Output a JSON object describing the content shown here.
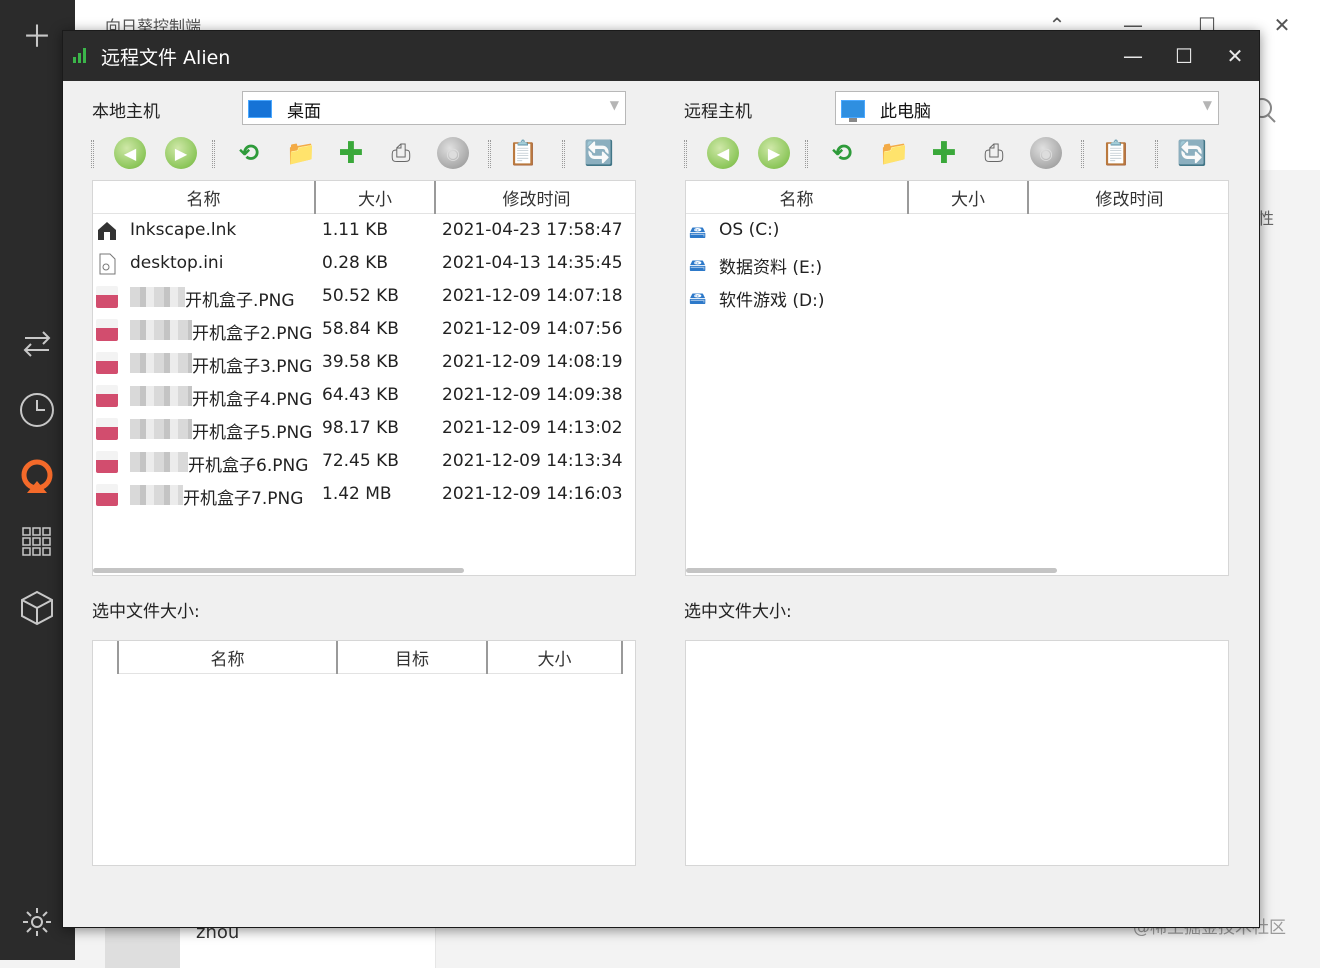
{
  "background_app": {
    "title": "向日葵控制端",
    "side_text": "性",
    "user": "zhou",
    "watermark": "@稀土掘金技术社区",
    "rail_icons": [
      "plus-icon",
      "transfer-icon",
      "clock-icon",
      "sunflower-logo-icon",
      "apps-icon",
      "cube-icon",
      "settings-icon"
    ],
    "window_controls": [
      "collapse-icon",
      "minimize-icon",
      "maximize-icon",
      "close-icon"
    ]
  },
  "dialog": {
    "title": "远程文件 Alien",
    "controls": {
      "minimize": "—",
      "maximize": "☐",
      "close": "✕"
    },
    "local": {
      "label": "本地主机",
      "location": "桌面",
      "columns": [
        "名称",
        "大小",
        "修改时间"
      ],
      "files": [
        {
          "name": "Inkscape.lnk",
          "size": "1.11 KB",
          "time": "2021-04-23 17:58:47",
          "icon": "shortcut-icon"
        },
        {
          "name": "desktop.ini",
          "size": "0.28 KB",
          "time": "2021-04-13 14:35:45",
          "icon": "ini-file-icon"
        },
        {
          "name": "开机盒子.PNG",
          "size": "50.52 KB",
          "time": "2021-12-09 14:07:18",
          "icon": "png-file-icon"
        },
        {
          "name": "开机盒子2.PNG",
          "size": "58.84 KB",
          "time": "2021-12-09 14:07:56",
          "icon": "png-file-icon"
        },
        {
          "name": "开机盒子3.PNG",
          "size": "39.58 KB",
          "time": "2021-12-09 14:08:19",
          "icon": "png-file-icon"
        },
        {
          "name": "开机盒子4.PNG",
          "size": "64.43 KB",
          "time": "2021-12-09 14:09:38",
          "icon": "png-file-icon"
        },
        {
          "name": "开机盒子5.PNG",
          "size": "98.17 KB",
          "time": "2021-12-09 14:13:02",
          "icon": "png-file-icon"
        },
        {
          "name": "开机盒子6.PNG",
          "size": "72.45 KB",
          "time": "2021-12-09 14:13:34",
          "icon": "png-file-icon"
        },
        {
          "name": "开机盒子7.PNG",
          "size": "1.42 MB",
          "time": "2021-12-09 14:16:03",
          "icon": "png-file-icon"
        }
      ],
      "selected_size_label": "选中文件大小:",
      "transfer_columns": [
        "名称",
        "目标",
        "大小"
      ]
    },
    "remote": {
      "label": "远程主机",
      "location": "此电脑",
      "columns": [
        "名称",
        "大小",
        "修改时间"
      ],
      "drives": [
        {
          "name": "OS (C:)",
          "icon": "drive-icon"
        },
        {
          "name": "数据资料 (E:)",
          "icon": "drive-icon"
        },
        {
          "name": "软件游戏 (D:)",
          "icon": "drive-icon"
        }
      ],
      "selected_size_label": "选中文件大小:"
    },
    "toolbar_icons": [
      "back-icon",
      "forward-icon",
      "refresh-icon",
      "up-folder-icon",
      "new-folder-icon",
      "print-icon",
      "disk-icon",
      "paste-icon",
      "transfer-icon"
    ]
  }
}
